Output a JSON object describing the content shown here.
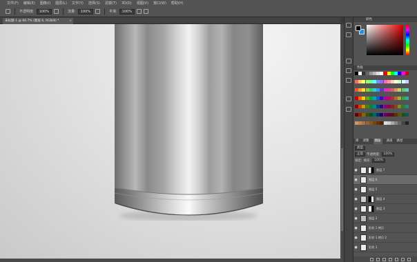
{
  "menubar": {
    "items": [
      "文件(F)",
      "编辑(E)",
      "图像(I)",
      "图层(L)",
      "文字(Y)",
      "选择(S)",
      "滤镜(T)",
      "3D(D)",
      "视图(V)",
      "窗口(W)",
      "帮助(H)"
    ]
  },
  "options": {
    "mode_label": "不透明度:",
    "opacity": "100%",
    "flow_label": "流量:",
    "flow": "100%",
    "smooth_label": "平滑:",
    "smooth": "100%"
  },
  "document": {
    "tab_title": "未标题-1 @ 66.7% (图层 6, RGB/8) *",
    "close": "×"
  },
  "color_panel": {
    "title": "颜色",
    "fg": "#000000",
    "bg": "#1e8ff0"
  },
  "swatches_panel": {
    "title": "色板"
  },
  "adjust_tabs": [
    "库",
    "调整",
    "图层",
    "通道",
    "路径"
  ],
  "layers_panel": {
    "kind_label": "类型",
    "mode": "正常",
    "opacity_label": "不透明度:",
    "opacity": "100%",
    "lock_label": "锁定:",
    "fill_label": "填充:",
    "fill": "100%"
  },
  "layers": [
    {
      "name": "图层 7",
      "has_mask": true
    },
    {
      "name": "图层 6",
      "has_mask": false
    },
    {
      "name": "图层 5",
      "has_mask": false
    },
    {
      "name": "图层 4",
      "has_mask": true
    },
    {
      "name": "图层 3",
      "has_mask": true
    },
    {
      "name": "图层 2",
      "has_mask": false
    },
    {
      "name": "形状 1 拷贝",
      "has_mask": false
    },
    {
      "name": "形状 1 拷贝 2",
      "has_mask": false
    },
    {
      "name": "形状 1",
      "has_mask": false
    }
  ]
}
